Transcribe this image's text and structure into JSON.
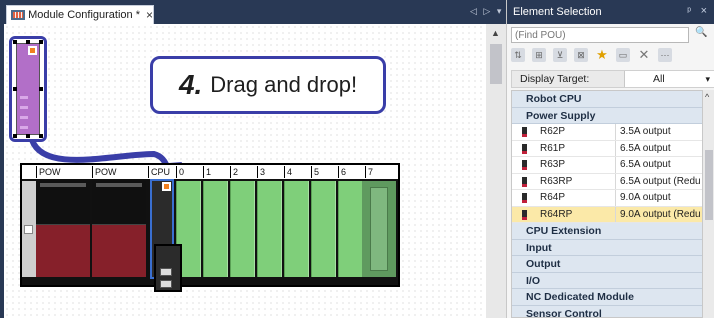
{
  "document_tab": {
    "title": "Module Configuration *",
    "close": "×"
  },
  "tab_nav": {
    "label": "◁ ▷ ▾"
  },
  "callout": {
    "step": "4.",
    "text": "Drag and drop!"
  },
  "slots": [
    "POW",
    "POW",
    "CPU",
    "0",
    "1",
    "2",
    "3",
    "4",
    "5",
    "6",
    "7"
  ],
  "element_selection": {
    "title": "Element Selection",
    "pin": "ᵖ",
    "close": "×",
    "find_placeholder": "(Find POU)",
    "display_target_label": "Display Target:",
    "display_target_value": "All",
    "categories_top": [
      "Robot CPU",
      "Power Supply"
    ],
    "power_supply_items": [
      {
        "name": "R62P",
        "desc": "3.5A output"
      },
      {
        "name": "R61P",
        "desc": "6.5A output"
      },
      {
        "name": "R63P",
        "desc": "6.5A output"
      },
      {
        "name": "R63RP",
        "desc": "6.5A output (Redu"
      },
      {
        "name": "R64P",
        "desc": "9.0A output"
      },
      {
        "name": "R64RP",
        "desc": "9.0A output (Redu"
      }
    ],
    "categories_bottom": [
      "CPU Extension",
      "Input",
      "Output",
      "I/O",
      "NC Dedicated Module",
      "Sensor Control"
    ],
    "selected_item": "R64RP"
  },
  "colors": {
    "accent": "#3a3ea8",
    "psu_red": "#86202a",
    "io_green": "#7fcf7a",
    "selection": "#fbe9a8",
    "titlebar": "#293955"
  }
}
